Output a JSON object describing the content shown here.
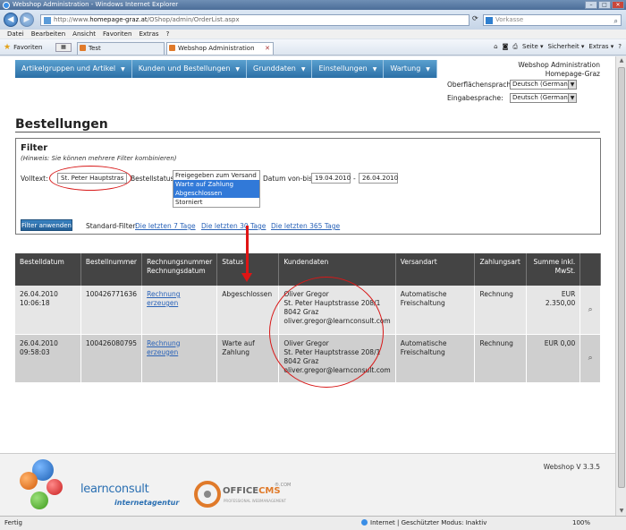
{
  "window": {
    "title": "Webshop Administration - Windows Internet Explorer",
    "url_prefix": "http://www.",
    "url_domain": "homepage-graz.at",
    "url_path": "/OShop/admin/OrderList.aspx",
    "search_text": "Vorkasse"
  },
  "menu": [
    "Datei",
    "Bearbeiten",
    "Ansicht",
    "Favoriten",
    "Extras",
    "?"
  ],
  "favorites_label": "Favoriten",
  "tabs": [
    {
      "label": "Test"
    },
    {
      "label": "Webshop Administration"
    }
  ],
  "toolbar": [
    "Seite ▾",
    "Sicherheit ▾",
    "Extras ▾"
  ],
  "nav": [
    {
      "label": "Artikelgruppen und Artikel"
    },
    {
      "label": "Kunden und Bestellungen"
    },
    {
      "label": "Grunddaten"
    },
    {
      "label": "Einstellungen"
    },
    {
      "label": "Wartung"
    }
  ],
  "site": {
    "title": "Webshop Administration",
    "subtitle": "Homepage-Graz",
    "ui_lang_label": "Oberflächensprache:",
    "ui_lang_value": "Deutsch (German)",
    "input_lang_label": "Eingabesprache:",
    "input_lang_value": "Deutsch (German)"
  },
  "page_title": "Bestellungen",
  "filter": {
    "title": "Filter",
    "hint": "(Hinweis: Sie können mehrere Filter kombinieren)",
    "fulltext_label": "Volltext:",
    "fulltext_value": "St. Peter Hauptstras",
    "status_label": "Bestellstatus:",
    "status_options": [
      "Freigegeben zum Versand",
      "Warte auf Zahlung",
      "Abgeschlossen",
      "Storniert"
    ],
    "date_label": "Datum von-bis:",
    "date_from": "19.04.2010",
    "date_sep": "-",
    "date_to": "26.04.2010",
    "apply_label": "Filter anwenden",
    "std_label": "Standard-Filter:",
    "std_links": [
      "Die letzten 7 Tage",
      "Die letzten 30 Tage",
      "Die letzten 365 Tage"
    ]
  },
  "table": {
    "headers": {
      "date": "Bestelldatum",
      "number": "Bestellnummer",
      "invoice_1": "Rechnungsnummer",
      "invoice_2": "Rechnungsdatum",
      "status": "Status",
      "customer": "Kundendaten",
      "shipping": "Versandart",
      "payment": "Zahlungsart",
      "total_1": "Summe inkl.",
      "total_2": "MwSt."
    },
    "rows": [
      {
        "date": "26.04.2010",
        "time": "10:06:18",
        "number": "100426771636",
        "invoice_link": "Rechnung erzeugen",
        "status": "Abgeschlossen",
        "customer_name": "Oliver Gregor",
        "customer_street": "St. Peter Hauptstrasse 208/1",
        "customer_city": "8042 Graz",
        "customer_email": "oliver.gregor@learnconsult.com",
        "shipping_1": "Automatische",
        "shipping_2": "Freischaltung",
        "payment": "Rechnung",
        "total": "EUR 2.350,00"
      },
      {
        "date": "26.04.2010",
        "time": "09:58:03",
        "number": "100426080795",
        "invoice_link": "Rechnung erzeugen",
        "status": "Warte auf Zahlung",
        "customer_name": "Oliver Gregor",
        "customer_street": "St. Peter Hauptstrasse 208/1",
        "customer_city": "8042 Graz",
        "customer_email": "oliver.gregor@learnconsult.com",
        "shipping_1": "Automatische",
        "shipping_2": "Freischaltung",
        "payment": "Rechnung",
        "total": "EUR 0,00"
      }
    ]
  },
  "footer": {
    "version": "Webshop V 3.3.5",
    "logo1_text": "learnconsult",
    "logo1_sub": "internetagentur",
    "logo2_text_a": "OFFICE",
    "logo2_text_b": "CMS",
    "logo2_tm": "®.COM",
    "logo2_tag": "PROFESSIONAL WEBMANAGEMENT"
  },
  "status_bar": {
    "left": "Fertig",
    "zone": "Internet | Geschützter Modus: Inaktiv",
    "zoom": "100%"
  },
  "colors": {
    "nav_blue": "#2b6fa6",
    "table_header": "#444444",
    "annotation_red": "#d81818",
    "link": "#2a63b8"
  },
  "icons": [
    "internet-explorer-icon",
    "back-icon",
    "forward-icon",
    "refresh-icon",
    "star-icon",
    "magnifier-icon",
    "globe-icon"
  ]
}
